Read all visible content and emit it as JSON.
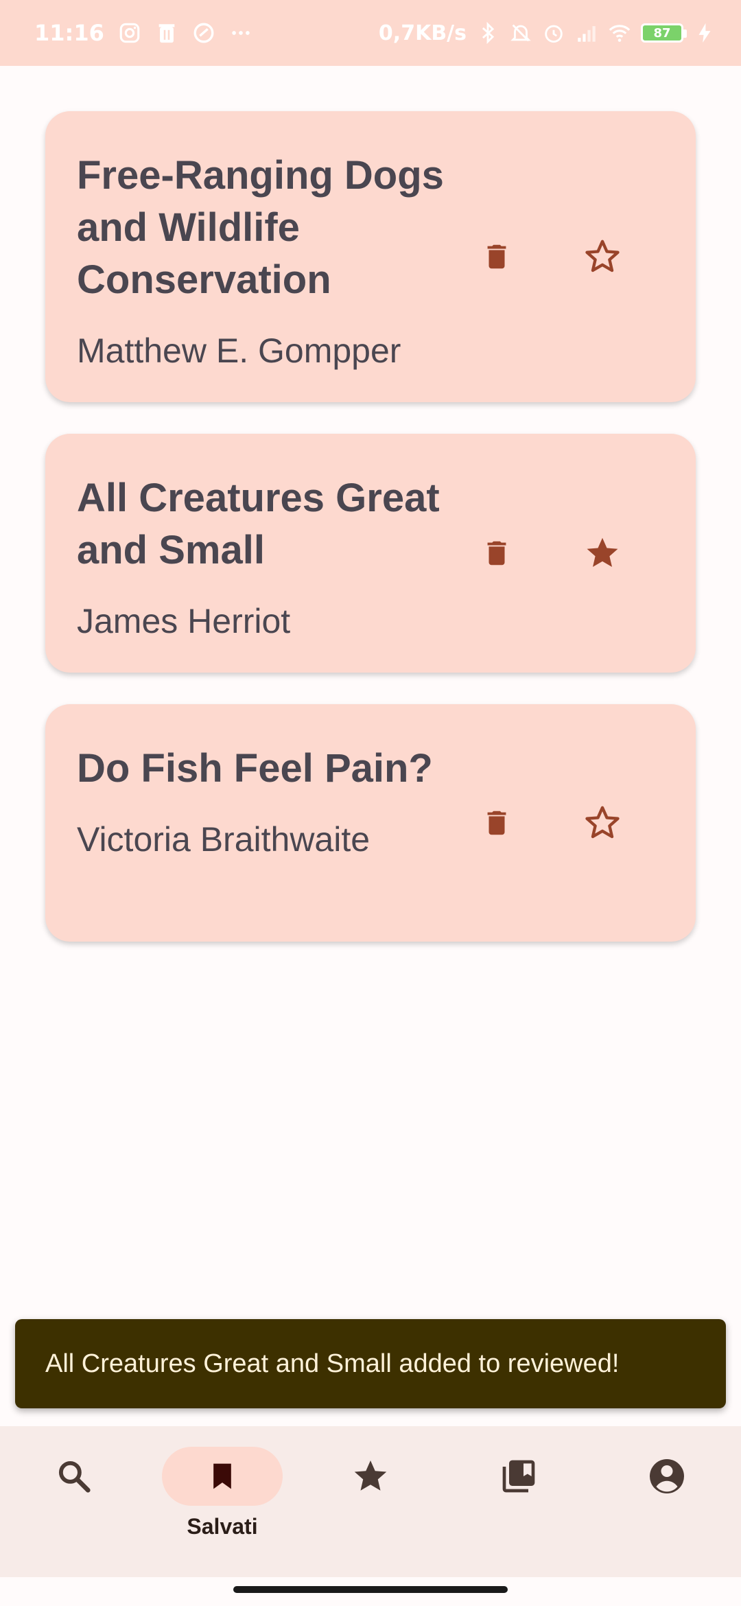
{
  "status_bar": {
    "time": "11:16",
    "network_speed": "0,7KB/s",
    "battery_level": "87",
    "icons_left": [
      "instagram-icon",
      "trash-notif-icon",
      "circle-app-icon",
      "more-dots-icon"
    ],
    "icons_right": [
      "bluetooth-icon",
      "bell-off-icon",
      "alarm-icon",
      "signal-icon",
      "wifi-icon",
      "battery-icon",
      "charging-icon"
    ]
  },
  "books": [
    {
      "title": "Free-Ranging Dogs and Wildlife Conservation",
      "author": "Matthew E. Gompper",
      "starred": false
    },
    {
      "title": "All Creatures Great and Small",
      "author": "James Herriot",
      "starred": true
    },
    {
      "title": "Do Fish Feel Pain?",
      "author": "Victoria Braithwaite",
      "starred": false
    }
  ],
  "snackbar": {
    "message": "All Creatures Great and Small added to reviewed!"
  },
  "bottom_nav": {
    "items": [
      {
        "icon": "search-icon",
        "label": "",
        "active": false
      },
      {
        "icon": "bookmark-icon",
        "label": "Salvati",
        "active": true
      },
      {
        "icon": "star-icon",
        "label": "",
        "active": false
      },
      {
        "icon": "library-icon",
        "label": "",
        "active": false
      },
      {
        "icon": "account-icon",
        "label": "",
        "active": false
      }
    ]
  },
  "colors": {
    "card_bg": "#fdd9cf",
    "icon_accent": "#99442a",
    "snackbar_bg": "#3d3000",
    "status_bar_bg": "#fdd9ce"
  }
}
